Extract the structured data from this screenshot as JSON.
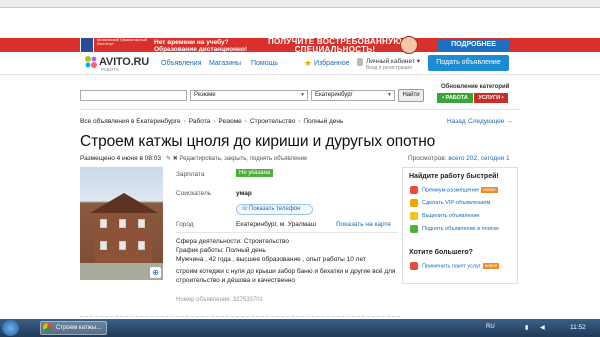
{
  "banner": {
    "institute": "Московский Гуманитарный Институт",
    "line1": "Нет времени на учебу?",
    "line2": "Образование дистанционно!",
    "headline1": "ПОЛУЧИТЕ ВОСТРЕБОВАННУЮ",
    "headline2": "СПЕЦИАЛЬНОСТЬ!",
    "more_button": "ПОДРОБНЕЕ"
  },
  "header": {
    "logo": "AVITO.RU",
    "logo_sub": "РАБОТА",
    "nav": [
      "Объявления",
      "Магазины",
      "Помощь"
    ],
    "favorites": "Избранное",
    "cabinet": "Личный кабинет ▾",
    "cabinet_sub": "Вход и регистрация",
    "post_button": "Подать объявление"
  },
  "search": {
    "query_value": "",
    "category": "Резюме",
    "city": "Екатеринбург",
    "find_button": "Найти",
    "updates_label": "Обновление категорий",
    "updates_work": "• РАБОТА",
    "updates_services": "УСЛУГИ •"
  },
  "breadcrumbs": [
    "Все объявления в Екатеринбурге",
    "Работа",
    "Резюме",
    "Строительство",
    "Полный день"
  ],
  "pager": {
    "back": "Назад",
    "next": "Следующее →"
  },
  "ad": {
    "title": "Строем катжы цноля до кириши и дуругых опотно",
    "posted": "Размещено 4 июня в 08:03",
    "actions": "✎ ✖ Редактировать, закрыть, поднять объявление",
    "views_label": "Просмотров:",
    "views_value": "всего 202, сегодня 1",
    "salary_label": "Зарплата",
    "salary_value": "Не указана",
    "seeker_label": "Соискатель",
    "seeker_value": "умар",
    "phone_button": "Показать телефон",
    "city_label": "Город",
    "city_value": "Екатеринбург, м. Уралмаш",
    "map_link": "Показать на карте",
    "sphere": "Сфера деятельности: Строительство",
    "schedule": "График работы: Полный день",
    "person": "Мужчина , 42 года , высшее образование , опыт работы 10 лет",
    "desc1": "строим котеджи с нуля до крыши забор баню и бехатки и другие всё для",
    "desc2": "строительство и дёшова и качественно",
    "ad_number": "Номер объявления: 327533701"
  },
  "aside": {
    "heading": "Найдите работу быстрей!",
    "items": [
      "Премиум-размещение",
      "Сделать VIP-объявлением",
      "Выделить объявление",
      "Поднять объявление в поиске"
    ],
    "new_badge": "новое",
    "heading2": "Хотите большего?",
    "package": "Применить пакет услуг"
  },
  "taskbar": {
    "app_title": "Строем катжы...",
    "lang": "RU",
    "time": "11:52"
  },
  "colors": {
    "banner": "#d9302b",
    "link": "#1a6bb8",
    "post_button": "#1c8bd1",
    "salary_badge": "#4caf3a"
  }
}
